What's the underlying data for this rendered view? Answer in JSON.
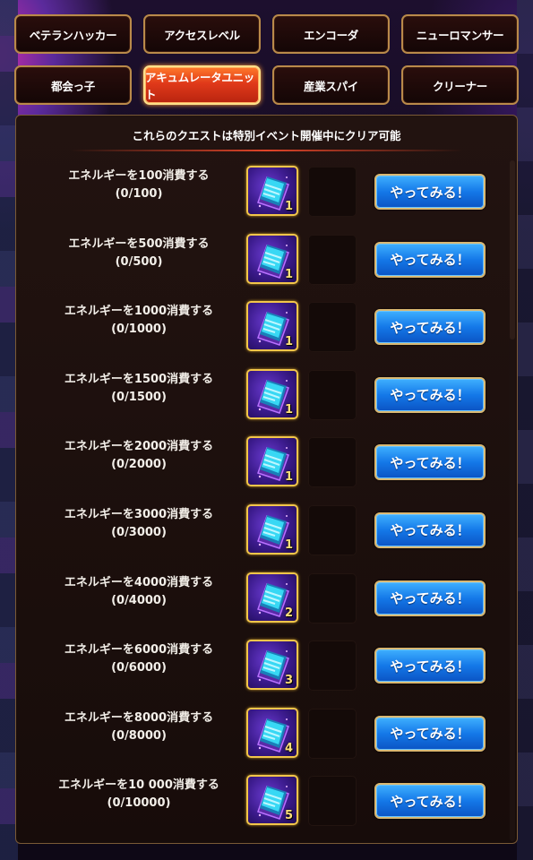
{
  "tabs": [
    {
      "label": "ベテランハッカー",
      "active": false
    },
    {
      "label": "アクセスレベル",
      "active": false
    },
    {
      "label": "エンコーダ",
      "active": false
    },
    {
      "label": "ニューロマンサー",
      "active": false
    },
    {
      "label": "都会っ子",
      "active": false
    },
    {
      "label": "アキュムレータユニット",
      "active": true
    },
    {
      "label": "産業スパイ",
      "active": false
    },
    {
      "label": "クリーナー",
      "active": false
    }
  ],
  "notice": "これらのクエストは特別イベント開催中にクリア可能",
  "button_label": "やってみる！",
  "quests": [
    {
      "title": "エネルギーを100消費する",
      "progress": "(0/100)",
      "reward_count": "1"
    },
    {
      "title": "エネルギーを500消費する",
      "progress": "(0/500)",
      "reward_count": "1"
    },
    {
      "title": "エネルギーを1000消費する",
      "progress": "(0/1000)",
      "reward_count": "1"
    },
    {
      "title": "エネルギーを1500消費する",
      "progress": "(0/1500)",
      "reward_count": "1"
    },
    {
      "title": "エネルギーを2000消費する",
      "progress": "(0/2000)",
      "reward_count": "1"
    },
    {
      "title": "エネルギーを3000消費する",
      "progress": "(0/3000)",
      "reward_count": "1"
    },
    {
      "title": "エネルギーを4000消費する",
      "progress": "(0/4000)",
      "reward_count": "2"
    },
    {
      "title": "エネルギーを6000消費する",
      "progress": "(0/6000)",
      "reward_count": "3"
    },
    {
      "title": "エネルギーを8000消費する",
      "progress": "(0/8000)",
      "reward_count": "4"
    },
    {
      "title": "エネルギーを10 000消費する",
      "progress": "(0/10000)",
      "reward_count": "5"
    }
  ],
  "reward_icon": "datapad-icon",
  "colors": {
    "tab_border": "#b98a4a",
    "tab_active": "#e0391a",
    "button_blue": "#1478e8",
    "reward_border": "#f2c64a"
  }
}
